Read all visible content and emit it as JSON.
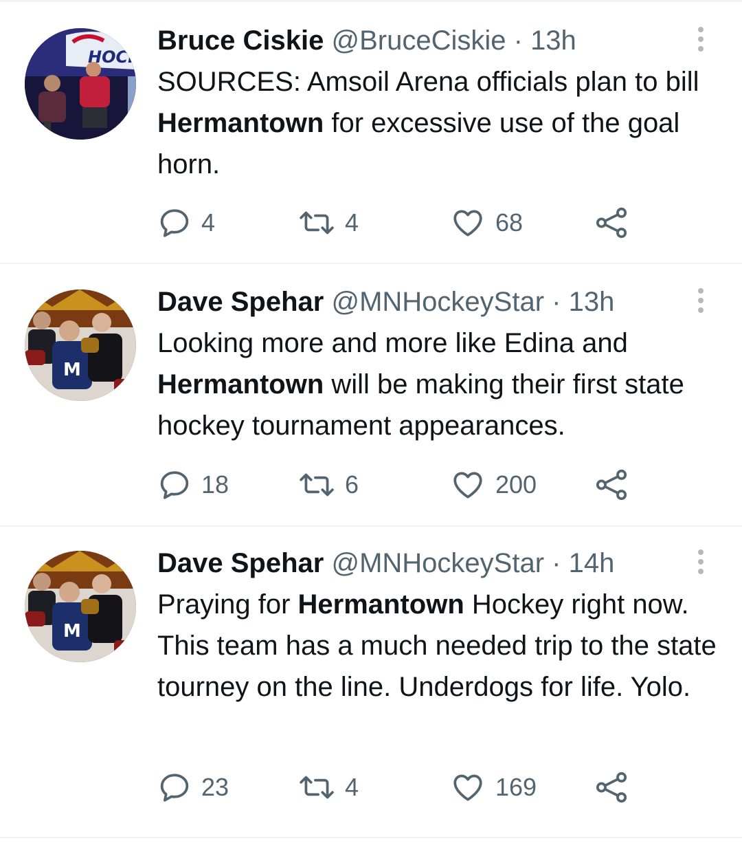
{
  "tweets": [
    {
      "author": "Bruce Ciskie",
      "handle": "@BruceCiskie",
      "separator": "·",
      "time": "13h",
      "avatar_icon": "profile-photo-hockey-panel",
      "text": [
        {
          "t": "SOURCES: Amsoil Arena officials plan to bill "
        },
        {
          "t": "Hermantown",
          "bold": true
        },
        {
          "t": " for excessive use of the goal horn."
        }
      ],
      "replies": "4",
      "retweets": "4",
      "likes": "68"
    },
    {
      "author": "Dave Spehar",
      "handle": "@MNHockeyStar",
      "separator": "·",
      "time": "13h",
      "avatar_icon": "profile-photo-hockey-players",
      "text": [
        {
          "t": "Looking more and more like Edina and "
        },
        {
          "t": "Hermantown",
          "bold": true
        },
        {
          "t": " will be making their first state hockey tournament appearances."
        }
      ],
      "replies": "18",
      "retweets": "6",
      "likes": "200"
    },
    {
      "author": "Dave Spehar",
      "handle": "@MNHockeyStar",
      "separator": "·",
      "time": "14h",
      "avatar_icon": "profile-photo-hockey-players",
      "text": [
        {
          "t": "Praying for "
        },
        {
          "t": "Hermantown",
          "bold": true
        },
        {
          "t": " Hockey right now. This team has a much needed trip to the state tourney on the line. Underdogs for life. Yolo."
        }
      ],
      "replies": "23",
      "retweets": "4",
      "likes": "169"
    }
  ],
  "colors": {
    "text": "#0f1419",
    "secondary": "#536471",
    "divider": "#eff3f4"
  }
}
